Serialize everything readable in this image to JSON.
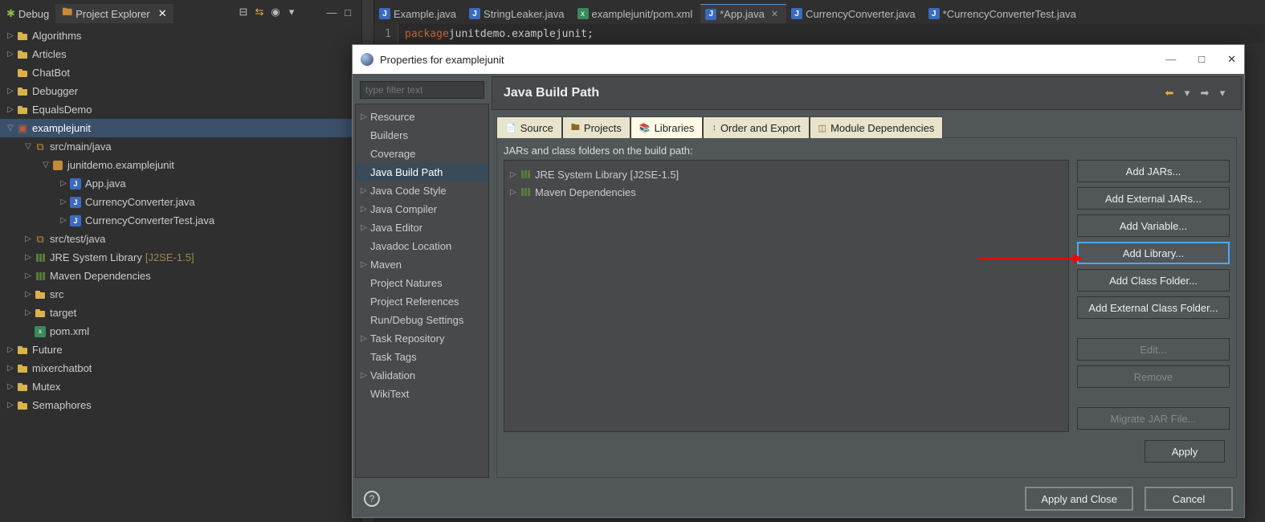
{
  "views": {
    "debug": "Debug",
    "explorer": "Project Explorer"
  },
  "editor_tabs": [
    {
      "label": "Example.java",
      "dirty": false,
      "kind": "java"
    },
    {
      "label": "StringLeaker.java",
      "dirty": false,
      "kind": "java"
    },
    {
      "label": "examplejunit/pom.xml",
      "dirty": false,
      "kind": "xml"
    },
    {
      "label": "*App.java",
      "dirty": true,
      "kind": "java",
      "active": true,
      "closeable": true
    },
    {
      "label": "CurrencyConverter.java",
      "dirty": false,
      "kind": "java"
    },
    {
      "label": "*CurrencyConverterTest.java",
      "dirty": true,
      "kind": "java"
    }
  ],
  "code": {
    "line_no": "1",
    "keyword": "package",
    "rest": " junitdemo.examplejunit;"
  },
  "explorer_tree": [
    {
      "d": 0,
      "tw": "▷",
      "ic": "folder",
      "label": "Algorithms"
    },
    {
      "d": 0,
      "tw": "▷",
      "ic": "folder",
      "label": "Articles"
    },
    {
      "d": 0,
      "tw": "",
      "ic": "folder",
      "label": "ChatBot"
    },
    {
      "d": 0,
      "tw": "▷",
      "ic": "folder",
      "label": "Debugger"
    },
    {
      "d": 0,
      "tw": "▷",
      "ic": "folder",
      "label": "EqualsDemo"
    },
    {
      "d": 0,
      "tw": "▽",
      "ic": "mvn",
      "label": "examplejunit",
      "selected": true
    },
    {
      "d": 1,
      "tw": "▽",
      "ic": "pkgfolder",
      "label": "src/main/java"
    },
    {
      "d": 2,
      "tw": "▽",
      "ic": "pkg",
      "label": "junitdemo.examplejunit"
    },
    {
      "d": 3,
      "tw": "▷",
      "ic": "java",
      "label": "App.java"
    },
    {
      "d": 3,
      "tw": "▷",
      "ic": "java",
      "label": "CurrencyConverter.java"
    },
    {
      "d": 3,
      "tw": "▷",
      "ic": "java",
      "label": "CurrencyConverterTest.java"
    },
    {
      "d": 1,
      "tw": "▷",
      "ic": "pkgfolder",
      "label": "src/test/java"
    },
    {
      "d": 1,
      "tw": "▷",
      "ic": "lib",
      "label": "JRE System Library",
      "extra": "[J2SE-1.5]"
    },
    {
      "d": 1,
      "tw": "▷",
      "ic": "lib",
      "label": "Maven Dependencies"
    },
    {
      "d": 1,
      "tw": "▷",
      "ic": "folder",
      "label": "src"
    },
    {
      "d": 1,
      "tw": "▷",
      "ic": "folder",
      "label": "target"
    },
    {
      "d": 1,
      "tw": "",
      "ic": "xml",
      "label": "pom.xml"
    },
    {
      "d": 0,
      "tw": "▷",
      "ic": "folder",
      "label": "Future"
    },
    {
      "d": 0,
      "tw": "▷",
      "ic": "folder",
      "label": "mixerchatbot"
    },
    {
      "d": 0,
      "tw": "▷",
      "ic": "folder",
      "label": "Mutex"
    },
    {
      "d": 0,
      "tw": "▷",
      "ic": "folder",
      "label": "Semaphores"
    }
  ],
  "dialog": {
    "title": "Properties for examplejunit",
    "filter_placeholder": "type filter text",
    "nav": [
      {
        "tw": "▷",
        "label": "Resource"
      },
      {
        "tw": "",
        "label": "Builders"
      },
      {
        "tw": "",
        "label": "Coverage"
      },
      {
        "tw": "",
        "label": "Java Build Path",
        "selected": true
      },
      {
        "tw": "▷",
        "label": "Java Code Style"
      },
      {
        "tw": "▷",
        "label": "Java Compiler"
      },
      {
        "tw": "▷",
        "label": "Java Editor"
      },
      {
        "tw": "",
        "label": "Javadoc Location"
      },
      {
        "tw": "▷",
        "label": "Maven"
      },
      {
        "tw": "",
        "label": "Project Natures"
      },
      {
        "tw": "",
        "label": "Project References"
      },
      {
        "tw": "",
        "label": "Run/Debug Settings"
      },
      {
        "tw": "▷",
        "label": "Task Repository"
      },
      {
        "tw": "",
        "label": "Task Tags"
      },
      {
        "tw": "▷",
        "label": "Validation"
      },
      {
        "tw": "",
        "label": "WikiText"
      }
    ],
    "header": "Java Build Path",
    "tabs": [
      "Source",
      "Projects",
      "Libraries",
      "Order and Export",
      "Module Dependencies"
    ],
    "active_tab": 2,
    "jars_label": "JARs and class folders on the build path:",
    "jars": [
      {
        "tw": "▷",
        "label": "JRE System Library [J2SE-1.5]"
      },
      {
        "tw": "▷",
        "label": "Maven Dependencies"
      }
    ],
    "buttons": {
      "add_jars": "Add JARs...",
      "add_ext_jars": "Add External JARs...",
      "add_variable": "Add Variable...",
      "add_library": "Add Library...",
      "add_class_folder": "Add Class Folder...",
      "add_ext_class_folder": "Add External Class Folder...",
      "edit": "Edit...",
      "remove": "Remove",
      "migrate": "Migrate JAR File...",
      "apply": "Apply",
      "apply_close": "Apply and Close",
      "cancel": "Cancel"
    }
  }
}
